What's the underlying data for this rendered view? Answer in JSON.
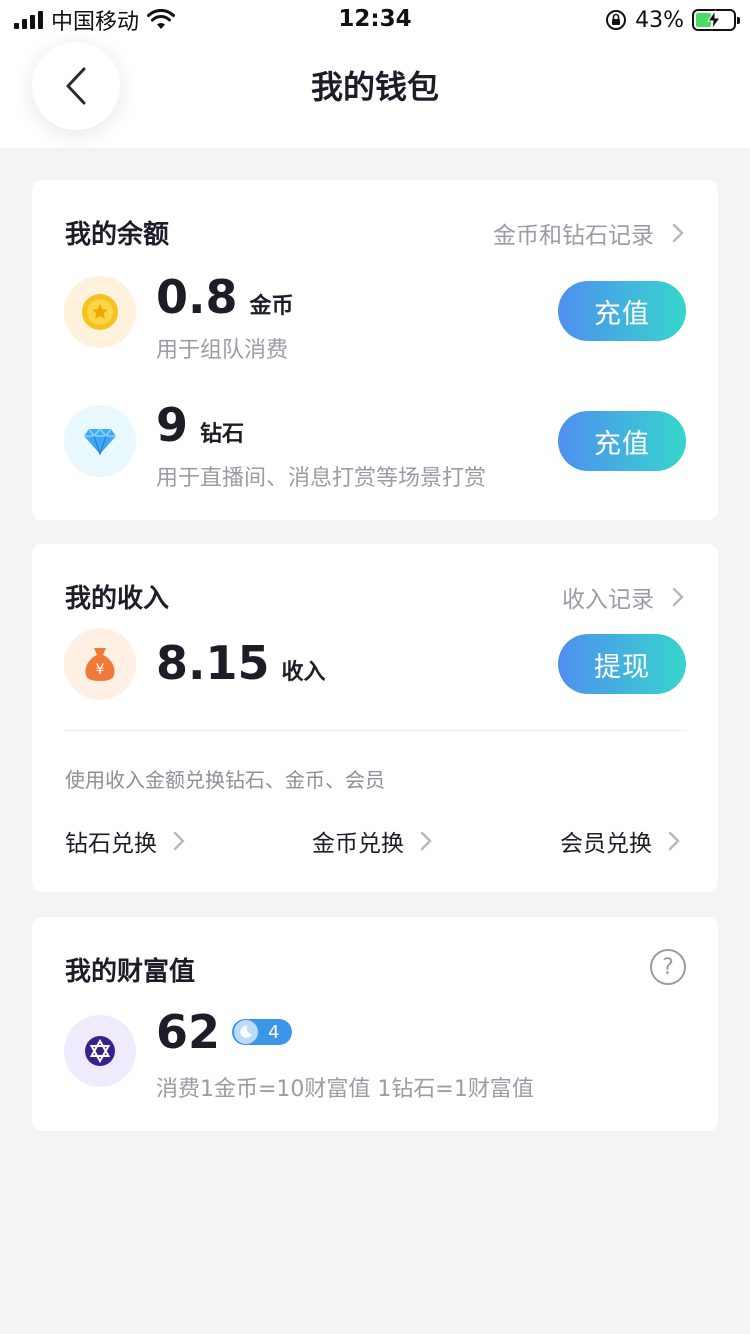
{
  "status_bar": {
    "carrier": "中国移动",
    "time": "12:34",
    "battery_percent": "43%",
    "battery_level": 0.43,
    "icons": [
      "signal-icon",
      "wifi-icon",
      "orientation-lock-icon",
      "battery-icon"
    ]
  },
  "nav": {
    "title": "我的钱包",
    "back_icon": "chevron-left-icon"
  },
  "balance": {
    "title": "我的余额",
    "link": "金币和钻石记录",
    "items": [
      {
        "icon": "gold-coin-icon",
        "amount": "0.8",
        "unit": "金币",
        "desc": "用于组队消费",
        "button": "充值"
      },
      {
        "icon": "diamond-icon",
        "amount": "9",
        "unit": "钻石",
        "desc": "用于直播间、消息打赏等场景打赏",
        "button": "充值"
      }
    ]
  },
  "income": {
    "title": "我的收入",
    "link": "收入记录",
    "amount": "8.15",
    "unit": "收入",
    "button": "提现",
    "icon": "money-bag-icon",
    "hint": "使用收入金额兑换钻石、金币、会员",
    "exchange": [
      "钻石兑换",
      "金币兑换",
      "会员兑换"
    ]
  },
  "wealth": {
    "title": "我的财富值",
    "help_icon": "question-circle-icon",
    "value": "62",
    "level": "4",
    "level_icon": "moon-icon",
    "icon": "star-of-david-icon",
    "desc": "消费1金币=10财富值 1钻石=1财富值"
  },
  "colors": {
    "background": "#f4f4f4",
    "card": "#ffffff",
    "text_primary": "#1c1d27",
    "text_secondary": "#9a9ca6",
    "button_gradient_start": "#4f8ff0",
    "button_gradient_end": "#36d6cc",
    "coin_bg": "#fff2dc",
    "diamond_bg": "#e8f8fc",
    "bag_bg": "#fff0e4",
    "wealth_bg": "#efeafc",
    "level_badge": "#3b96e8"
  }
}
